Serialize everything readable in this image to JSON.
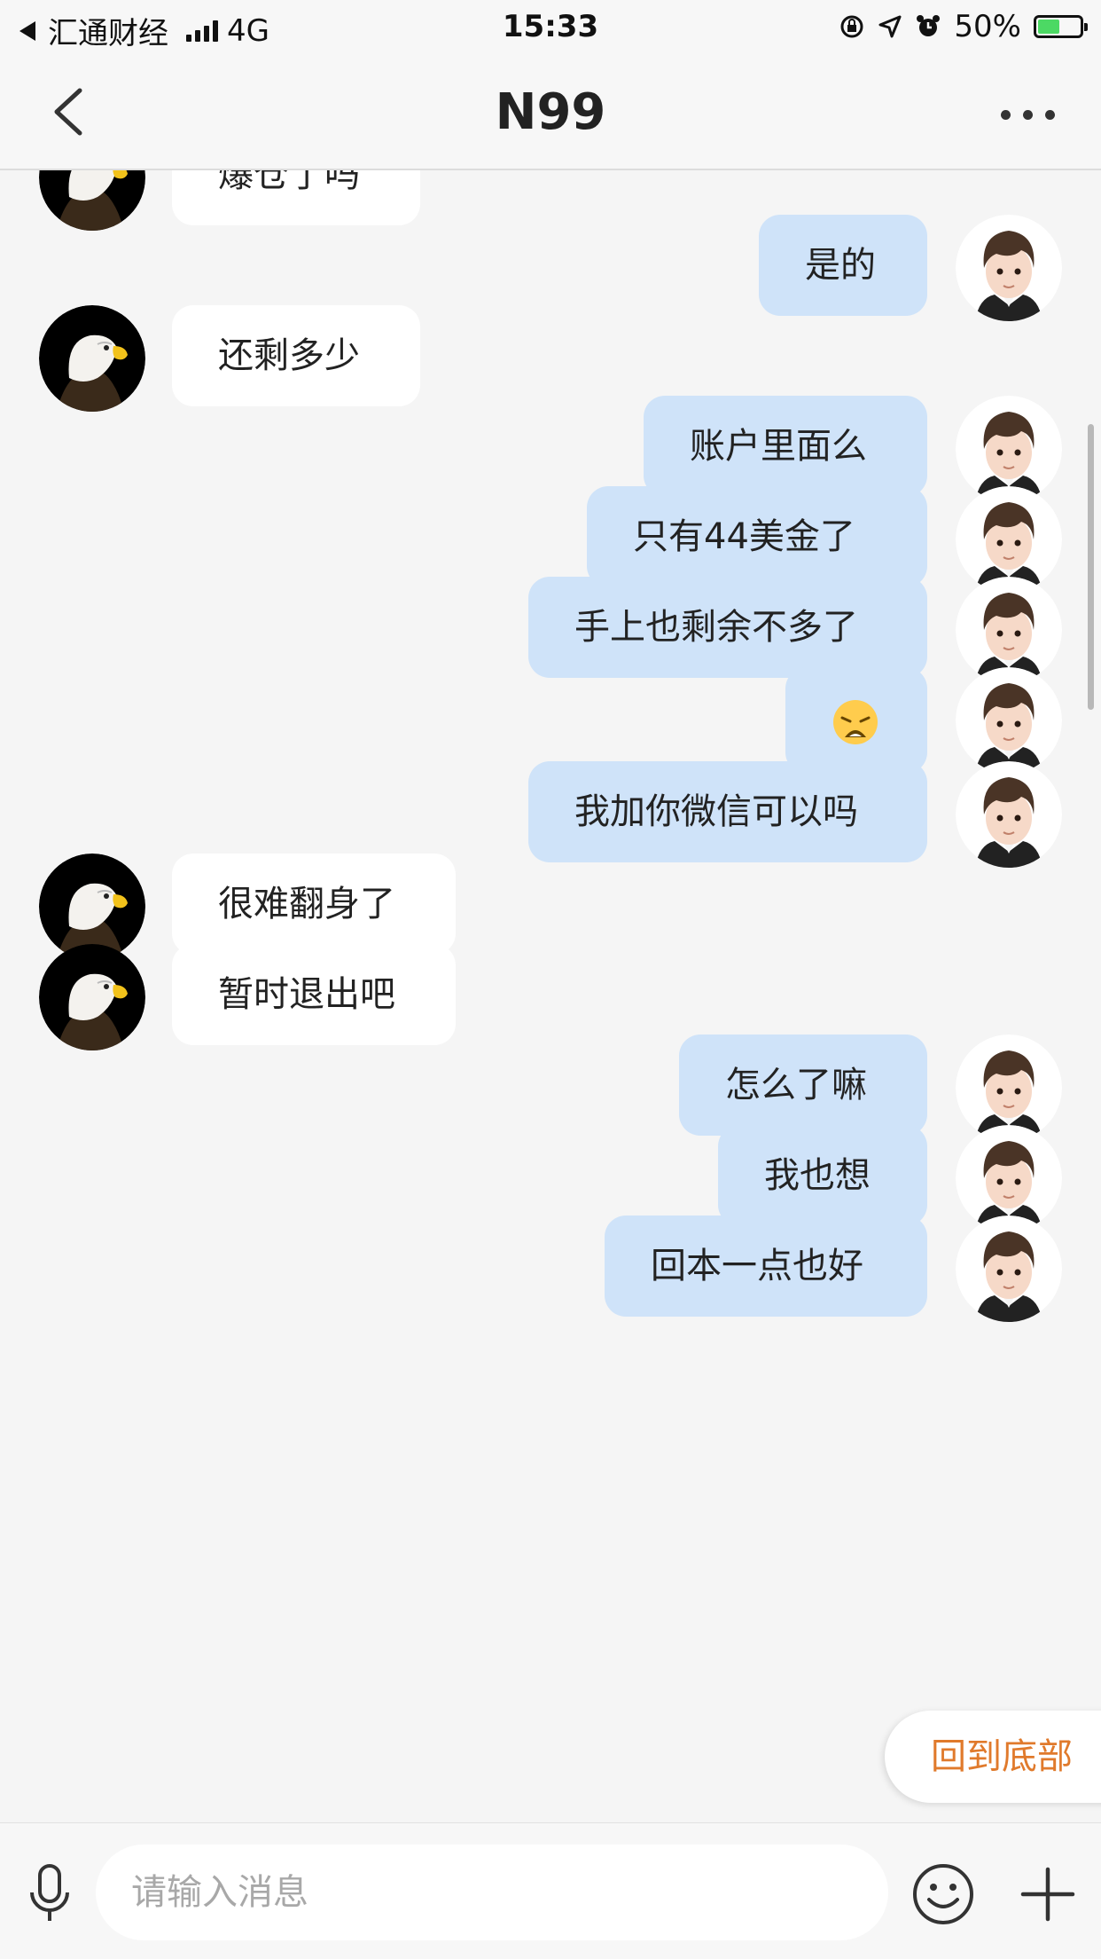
{
  "status_bar": {
    "carrier": "汇通财经",
    "network": "4G",
    "time": "15:33",
    "battery": "50%",
    "battery_level": 0.5
  },
  "header": {
    "title": "N99"
  },
  "messages": [
    {
      "side": "left",
      "text": "爆仓了吗"
    },
    {
      "side": "right",
      "text": "是的"
    },
    {
      "side": "left",
      "text": "还剩多少"
    },
    {
      "side": "right",
      "text": "账户里面么"
    },
    {
      "side": "right",
      "text": "只有44美金了"
    },
    {
      "side": "right",
      "text": "手上也剩余不多了"
    },
    {
      "side": "right",
      "emoji": "weary-face"
    },
    {
      "side": "right",
      "text": "我加你微信可以吗"
    },
    {
      "side": "left",
      "text": "很难翻身了"
    },
    {
      "side": "left",
      "text": "暂时退出吧"
    },
    {
      "side": "right",
      "text": "怎么了嘛"
    },
    {
      "side": "right",
      "text": "我也想"
    },
    {
      "side": "right",
      "text": "回本一点也好"
    }
  ],
  "back_to_bottom_label": "回到底部",
  "input": {
    "placeholder": "请输入消息"
  },
  "colors": {
    "accent_orange": "#e07a2c",
    "sent_bubble": "#cfe3f9",
    "received_bubble": "#ffffff"
  }
}
